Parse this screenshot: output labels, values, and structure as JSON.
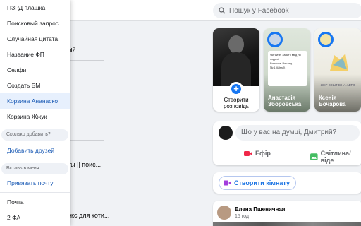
{
  "search": {
    "placeholder": "Пошук у Facebook"
  },
  "background": {
    "left_snippets": [
      "ый",
      "ты || поис...",
      "нкс для коти..."
    ]
  },
  "stories": {
    "create_label": "Створити розповідь",
    "items": [
      {
        "name": "Анастасія Зборовська",
        "card_lines": [
          "Читайте, запит і ввід по подачі",
          "Виписки, Виклад...",
          "№ 1 (Штаб)"
        ]
      },
      {
        "name": "Ксенія Бочарова",
        "card_lines": [
          "ЗБІР КОШТІВ НА АВТО"
        ]
      }
    ]
  },
  "composer": {
    "placeholder": "Що у вас на думці, Дмитрий?",
    "live_label": "Ефір",
    "photo_label": "Світлина/віде"
  },
  "room": {
    "label": "Створити кімнату"
  },
  "post": {
    "author": "Елена Пшеничная",
    "time": "15 год"
  },
  "menu": {
    "items": [
      "ПЗРД плашка",
      "Поисковый запрос",
      "Случайная цитата",
      "Название ФП",
      "Селфи",
      "Создать БМ",
      "Корзина Ананаско",
      "Корзина Жжук"
    ],
    "hint_count": "Сколько добавить?",
    "add_friends": "Добавить друзей",
    "hint_insert": "Вставь в меня",
    "link_mail": "Привязать почту",
    "mail": "Почта",
    "twofa": "2 ФА"
  },
  "colors": {
    "accent": "#1877f2",
    "active_bg": "#e7f0fd",
    "live": "#f02849",
    "photo": "#45bd62",
    "room": "#a33ddd"
  }
}
